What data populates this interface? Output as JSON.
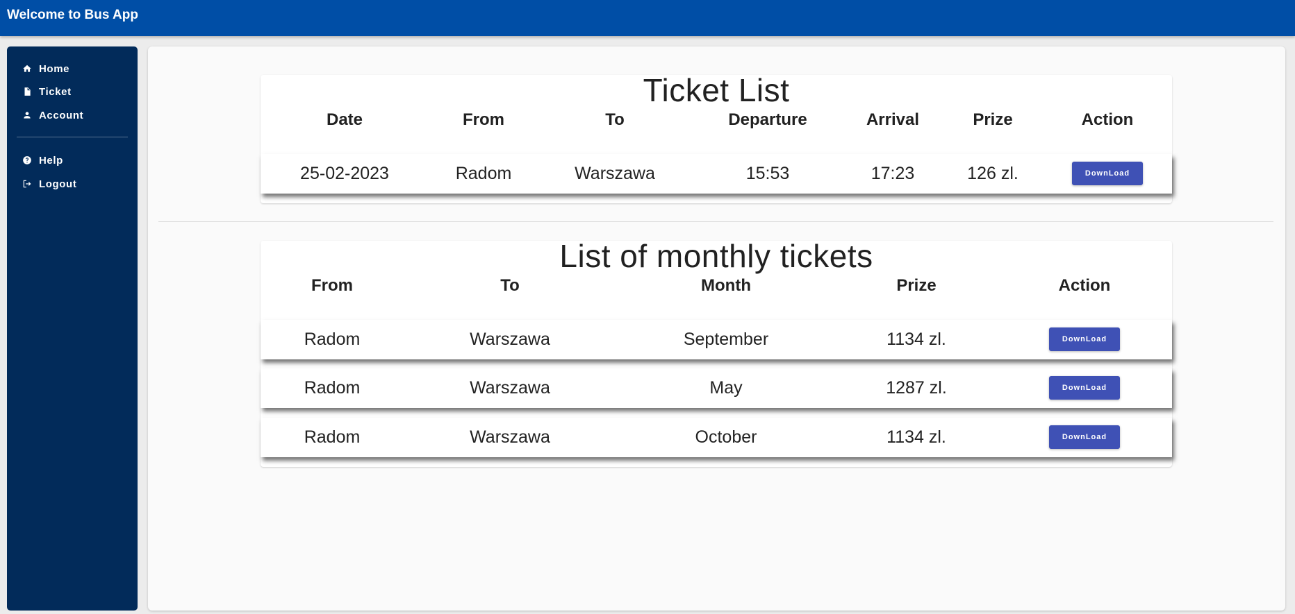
{
  "header": {
    "title": "Welcome to Bus App"
  },
  "sidebar": {
    "items": [
      {
        "label": "Home",
        "icon": "home-icon"
      },
      {
        "label": "Ticket",
        "icon": "document-icon"
      },
      {
        "label": "Account",
        "icon": "person-icon"
      }
    ],
    "secondary_items": [
      {
        "label": "Help",
        "icon": "help-icon"
      },
      {
        "label": "Logout",
        "icon": "logout-icon"
      }
    ]
  },
  "ticket_list": {
    "title": "Ticket List",
    "columns": [
      "Date",
      "From",
      "To",
      "Departure",
      "Arrival",
      "Prize",
      "Action"
    ],
    "rows": [
      {
        "date": "25-02-2023",
        "from": "Radom",
        "to": "Warszawa",
        "departure": "15:53",
        "arrival": "17:23",
        "prize": "126 zl.",
        "action": "DownLoad"
      }
    ]
  },
  "monthly_tickets": {
    "title": "List of monthly tickets",
    "columns": [
      "From",
      "To",
      "Month",
      "Prize",
      "Action"
    ],
    "rows": [
      {
        "from": "Radom",
        "to": "Warszawa",
        "month": "September",
        "prize": "1134 zl.",
        "action": "DownLoad"
      },
      {
        "from": "Radom",
        "to": "Warszawa",
        "month": "May",
        "prize": "1287 zl.",
        "action": "DownLoad"
      },
      {
        "from": "Radom",
        "to": "Warszawa",
        "month": "October",
        "prize": "1134 zl.",
        "action": "DownLoad"
      }
    ]
  },
  "colors": {
    "topbar": "#004ea6",
    "sidebar": "#022b5a",
    "button": "#3f51b5"
  }
}
